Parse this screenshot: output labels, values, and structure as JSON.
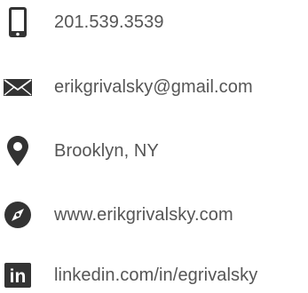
{
  "contact": {
    "icon_color": "#333333",
    "text_color": "#555555",
    "items": [
      {
        "icon": "phone-icon",
        "text": "201.539.3539"
      },
      {
        "icon": "envelope-icon",
        "text": "erikgrivalsky@gmail.com"
      },
      {
        "icon": "map-pin-icon",
        "text": "Brooklyn, NY"
      },
      {
        "icon": "compass-icon",
        "text": "www.erikgrivalsky.com"
      },
      {
        "icon": "linkedin-icon",
        "text": "linkedin.com/in/egrivalsky",
        "logo_text": "in"
      }
    ]
  }
}
